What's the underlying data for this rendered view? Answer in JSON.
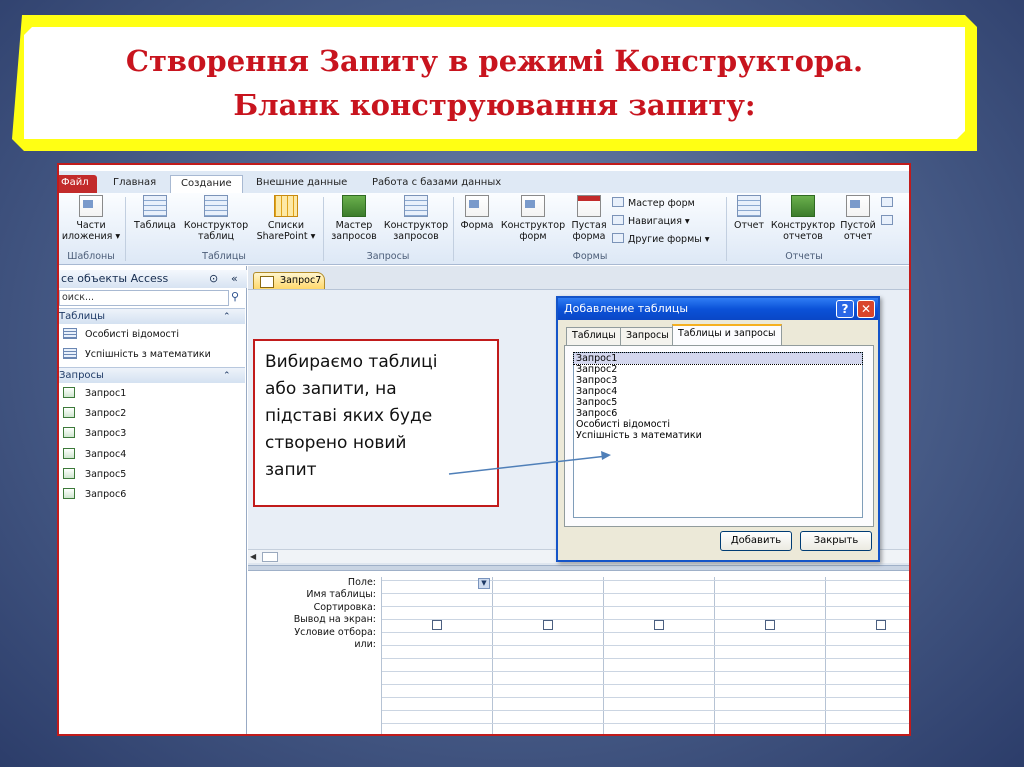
{
  "slide": {
    "title_line1": "Створення Запиту в режимі Конструктора.",
    "title_line2": "Бланк конструювання запиту:"
  },
  "ribbon": {
    "tabs": [
      "Файл",
      "Главная",
      "Создание",
      "Внешние данные",
      "Работа с базами данных"
    ],
    "active_tab": "Создание",
    "buttons": {
      "parts_line1": "Части",
      "parts_line2": "иложения ▾",
      "table": "Таблица",
      "table_constructor_line1": "Конструктор",
      "table_constructor_line2": "таблиц",
      "sharepoint_line1": "Списки",
      "sharepoint_line2": "SharePoint ▾",
      "query_wizard_line1": "Мастер",
      "query_wizard_line2": "запросов",
      "query_constructor_line1": "Конструктор",
      "query_constructor_line2": "запросов",
      "form": "Форма",
      "form_constructor_line1": "Конструктор",
      "form_constructor_line2": "форм",
      "blank_form_line1": "Пустая",
      "blank_form_line2": "форма",
      "form_wizard": "Мастер форм",
      "navigation": "Навигация ▾",
      "other_forms": "Другие формы ▾",
      "report": "Отчет",
      "report_constructor_line1": "Конструктор",
      "report_constructor_line2": "отчетов",
      "blank_report_line1": "Пустой",
      "blank_report_line2": "отчет"
    },
    "groups": [
      "Шаблоны",
      "Таблицы",
      "Запросы",
      "Формы",
      "Отчеты"
    ]
  },
  "nav_pane": {
    "header": "се объекты Access",
    "search_placeholder": "оиск...",
    "groups": [
      {
        "label": "Таблицы",
        "items": [
          "Особисті відомості",
          "Успішність з математики"
        ]
      },
      {
        "label": "Запросы",
        "items": [
          "Запрос1",
          "Запрос2",
          "Запрос3",
          "Запрос4",
          "Запрос5",
          "Запрос6"
        ]
      }
    ]
  },
  "document_tab": "Запрос7",
  "qbe_grid": {
    "row_labels": [
      "Поле:",
      "Имя таблицы:",
      "Сортировка:",
      "Вывод на экран:",
      "Условие отбора:",
      "или:"
    ]
  },
  "dialog": {
    "title": "Добавление таблицы",
    "help_button": "?",
    "close_button": "✕",
    "tabs": [
      "Таблицы",
      "Запросы",
      "Таблицы и запросы"
    ],
    "active_tab": "Таблицы и запросы",
    "items": [
      "Запрос1",
      "Запрос2",
      "Запрос3",
      "Запрос4",
      "Запрос5",
      "Запрос6",
      "Особисті відомості",
      "Успішність з математики"
    ],
    "selected_item": "Запрос1",
    "add_button": "Добавить",
    "close_label": "Закрыть"
  },
  "callout": {
    "line1": "Вибираємо таблиці",
    "line2": "або запити, на",
    "line3": "підставі яких буде",
    "line4": "створено новий",
    "line5": "запит"
  },
  "colors": {
    "title_text": "#c8141e",
    "banner_border": "#ffff14",
    "frame_border": "#c11b1b",
    "dialog_title_bar": "#0b52d8"
  }
}
